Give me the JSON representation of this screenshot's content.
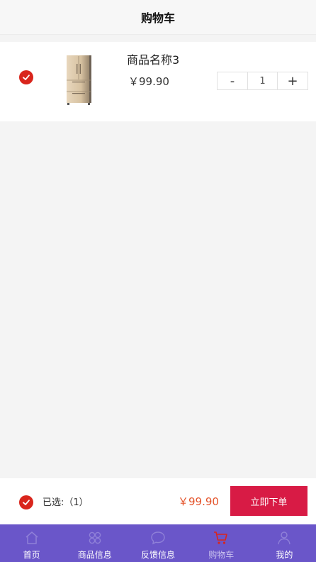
{
  "header": {
    "title": "购物车"
  },
  "cart": {
    "items": [
      {
        "name": "商品名称3",
        "price": "￥99.90",
        "quantity": "1",
        "checked": true,
        "image": "refrigerator-image"
      }
    ],
    "decrement_label": "-",
    "increment_label": "+"
  },
  "checkout": {
    "selected_label": "已选:（1）",
    "total": "￥99.90",
    "order_button": "立即下单"
  },
  "tabbar": {
    "tabs": [
      {
        "label": "首页",
        "icon": "home-icon"
      },
      {
        "label": "商品信息",
        "icon": "grid-icon"
      },
      {
        "label": "反馈信息",
        "icon": "chat-icon"
      },
      {
        "label": "购物车",
        "icon": "cart-icon",
        "active": true
      },
      {
        "label": "我的",
        "icon": "user-icon"
      }
    ]
  },
  "colors": {
    "accent": "#d9251c",
    "order_button": "#d81b45",
    "price": "#e4542b",
    "tabbar": "#6a56c9"
  }
}
